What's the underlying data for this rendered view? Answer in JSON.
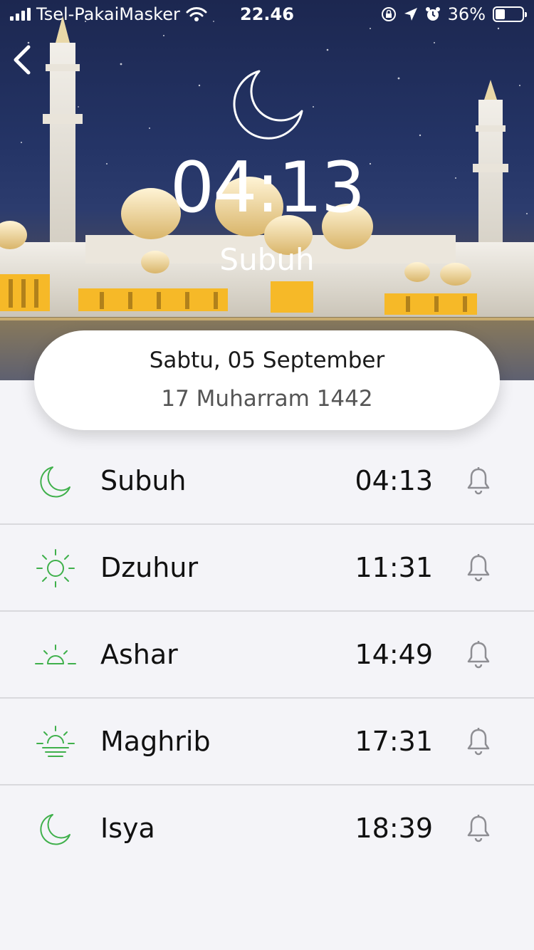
{
  "status_bar": {
    "carrier": "Tsel-PakaiMasker",
    "time": "22.46",
    "battery": "36%",
    "battery_level": 0.36
  },
  "hero": {
    "current_time": "04:13",
    "current_prayer": "Subuh",
    "icon": "crescent-moon-icon"
  },
  "date": {
    "gregorian": "Sabtu, 05 September",
    "hijri": "17 Muharram 1442"
  },
  "accent_color": "#3fb04b",
  "prayers": [
    {
      "name": "Subuh",
      "time": "04:13",
      "icon": "crescent-moon-icon"
    },
    {
      "name": "Dzuhur",
      "time": "11:31",
      "icon": "sun-icon"
    },
    {
      "name": "Ashar",
      "time": "14:49",
      "icon": "sun-half-icon"
    },
    {
      "name": "Maghrib",
      "time": "17:31",
      "icon": "sunset-icon"
    },
    {
      "name": "Isya",
      "time": "18:39",
      "icon": "crescent-moon-icon"
    }
  ]
}
